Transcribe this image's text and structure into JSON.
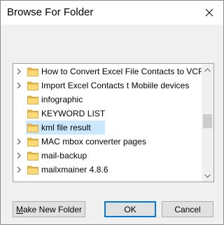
{
  "dialog": {
    "title": "Browse For Folder",
    "close_icon": "close-x-icon"
  },
  "tree": {
    "items": [
      {
        "label": "How to Convert Excel File Contacts to VCF (",
        "expandable": true,
        "selected": false
      },
      {
        "label": "Import Excel Contacts t  Mobiile devices",
        "expandable": true,
        "selected": false
      },
      {
        "label": "infographic",
        "expandable": false,
        "selected": false
      },
      {
        "label": "KEYWORD LIST",
        "expandable": false,
        "selected": false
      },
      {
        "label": "kml file result",
        "expandable": false,
        "selected": true
      },
      {
        "label": "MAC mbox converter pages",
        "expandable": true,
        "selected": false
      },
      {
        "label": "mail-backup",
        "expandable": true,
        "selected": false
      },
      {
        "label": "mailxmainer 4.8.6",
        "expandable": true,
        "selected": false
      }
    ],
    "folder_icon": "folder-icon",
    "chevron_icon": "chevron-right-icon"
  },
  "buttons": {
    "make_new_folder_mnemonic": "M",
    "make_new_folder_rest": "ake New Folder",
    "ok": "OK",
    "cancel": "Cancel"
  },
  "colors": {
    "selection": "#cce8ff",
    "folder": "#ffd978",
    "default_border": "#0078d7"
  }
}
